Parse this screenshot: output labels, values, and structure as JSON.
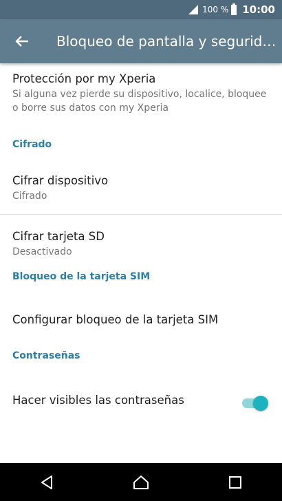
{
  "status_bar": {
    "battery": "100 %",
    "time": "10:00"
  },
  "toolbar": {
    "title": "Bloqueo de pantalla y seguridad"
  },
  "items": {
    "xperia": {
      "title": "Protección por my Xperia",
      "summary": "Si alguna vez pierde su dispositivo, localice, bloquee o borre sus datos con my Xperia"
    },
    "encrypt_device": {
      "title": "Cifrar dispositivo",
      "summary": "Cifrado"
    },
    "encrypt_sd": {
      "title": "Cifrar tarjeta SD",
      "summary": "Desactivado"
    },
    "sim_lock": {
      "title": "Configurar bloqueo de la tarjeta SIM"
    },
    "show_passwords": {
      "title": "Hacer visibles las contraseñas",
      "enabled": true
    }
  },
  "sections": {
    "encryption": "Cifrado",
    "sim_lock": "Bloqueo de la tarjeta SIM",
    "passwords": "Contraseñas"
  },
  "colors": {
    "toolbar": "#607d8f",
    "status_bar": "#4f6a7c",
    "section_header": "#2a7fa8",
    "toggle_on": "#1bb3c0"
  }
}
